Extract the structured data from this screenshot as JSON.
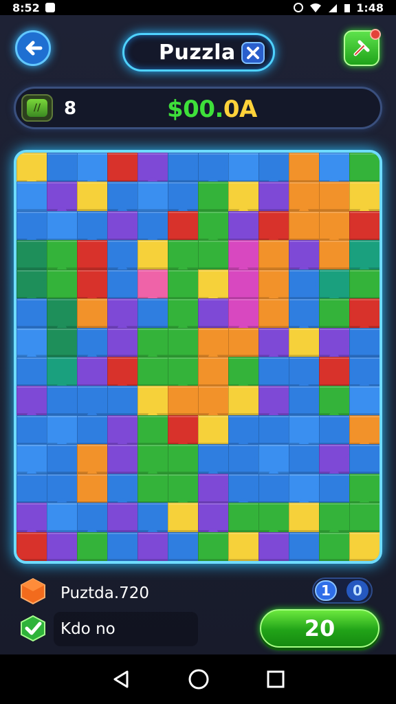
{
  "status_bar": {
    "left_text": "8:52",
    "right_text": "1:48"
  },
  "header": {
    "title": "Puzzla",
    "back_icon": "arrow-left-icon",
    "close_icon": "close-icon",
    "corner_icon": "wrench-icon"
  },
  "info_bar": {
    "level_icon_text": "//",
    "level": "8",
    "money": "$00.0A"
  },
  "puzzle": {
    "rows": 14,
    "cols": 12,
    "colors": {
      "blue": "#2f7ee0",
      "lblue": "#3a8ff0",
      "purple": "#7e49d6",
      "red": "#d8322b",
      "yellow": "#f6d13a",
      "orange": "#f2922a",
      "green": "#34b33a",
      "dgreen": "#1e8f5a",
      "magenta": "#d848c0",
      "pink": "#ef63a8",
      "teal": "#1aa07e"
    },
    "grid": [
      [
        "yellow",
        "blue",
        "lblue",
        "red",
        "purple",
        "blue",
        "blue",
        "lblue",
        "blue",
        "orange",
        "lblue",
        "green"
      ],
      [
        "lblue",
        "purple",
        "yellow",
        "blue",
        "lblue",
        "blue",
        "green",
        "yellow",
        "purple",
        "orange",
        "orange",
        "yellow"
      ],
      [
        "blue",
        "lblue",
        "blue",
        "purple",
        "blue",
        "red",
        "green",
        "purple",
        "red",
        "orange",
        "orange",
        "red"
      ],
      [
        "dgreen",
        "green",
        "red",
        "blue",
        "yellow",
        "green",
        "green",
        "magenta",
        "orange",
        "purple",
        "orange",
        "teal"
      ],
      [
        "dgreen",
        "green",
        "red",
        "blue",
        "pink",
        "green",
        "yellow",
        "magenta",
        "orange",
        "blue",
        "teal",
        "green"
      ],
      [
        "blue",
        "dgreen",
        "orange",
        "purple",
        "blue",
        "green",
        "purple",
        "magenta",
        "orange",
        "blue",
        "green",
        "red"
      ],
      [
        "lblue",
        "dgreen",
        "blue",
        "purple",
        "green",
        "green",
        "orange",
        "orange",
        "purple",
        "yellow",
        "purple",
        "blue"
      ],
      [
        "blue",
        "teal",
        "purple",
        "red",
        "green",
        "green",
        "orange",
        "green",
        "blue",
        "blue",
        "red",
        "blue"
      ],
      [
        "purple",
        "blue",
        "blue",
        "blue",
        "yellow",
        "orange",
        "orange",
        "yellow",
        "purple",
        "blue",
        "green",
        "lblue"
      ],
      [
        "blue",
        "lblue",
        "blue",
        "purple",
        "green",
        "red",
        "yellow",
        "blue",
        "blue",
        "lblue",
        "blue",
        "orange"
      ],
      [
        "lblue",
        "blue",
        "orange",
        "purple",
        "green",
        "green",
        "blue",
        "blue",
        "lblue",
        "blue",
        "purple",
        "blue"
      ],
      [
        "blue",
        "blue",
        "orange",
        "blue",
        "green",
        "green",
        "purple",
        "blue",
        "blue",
        "lblue",
        "blue",
        "green"
      ],
      [
        "purple",
        "lblue",
        "blue",
        "purple",
        "blue",
        "yellow",
        "purple",
        "green",
        "green",
        "yellow",
        "green",
        "green"
      ],
      [
        "red",
        "purple",
        "green",
        "blue",
        "purple",
        "blue",
        "green",
        "yellow",
        "purple",
        "blue",
        "green",
        "yellow"
      ]
    ]
  },
  "bottom": {
    "stat_label": "Puztda.720",
    "toggle_left": "1",
    "toggle_right": "0",
    "kdo_label": "Kdo no",
    "play_label": "20"
  },
  "colors": {
    "money_green": "#3ee03a",
    "money_yellow": "#ffd23a",
    "accent_cyan": "#4fd2ff"
  }
}
